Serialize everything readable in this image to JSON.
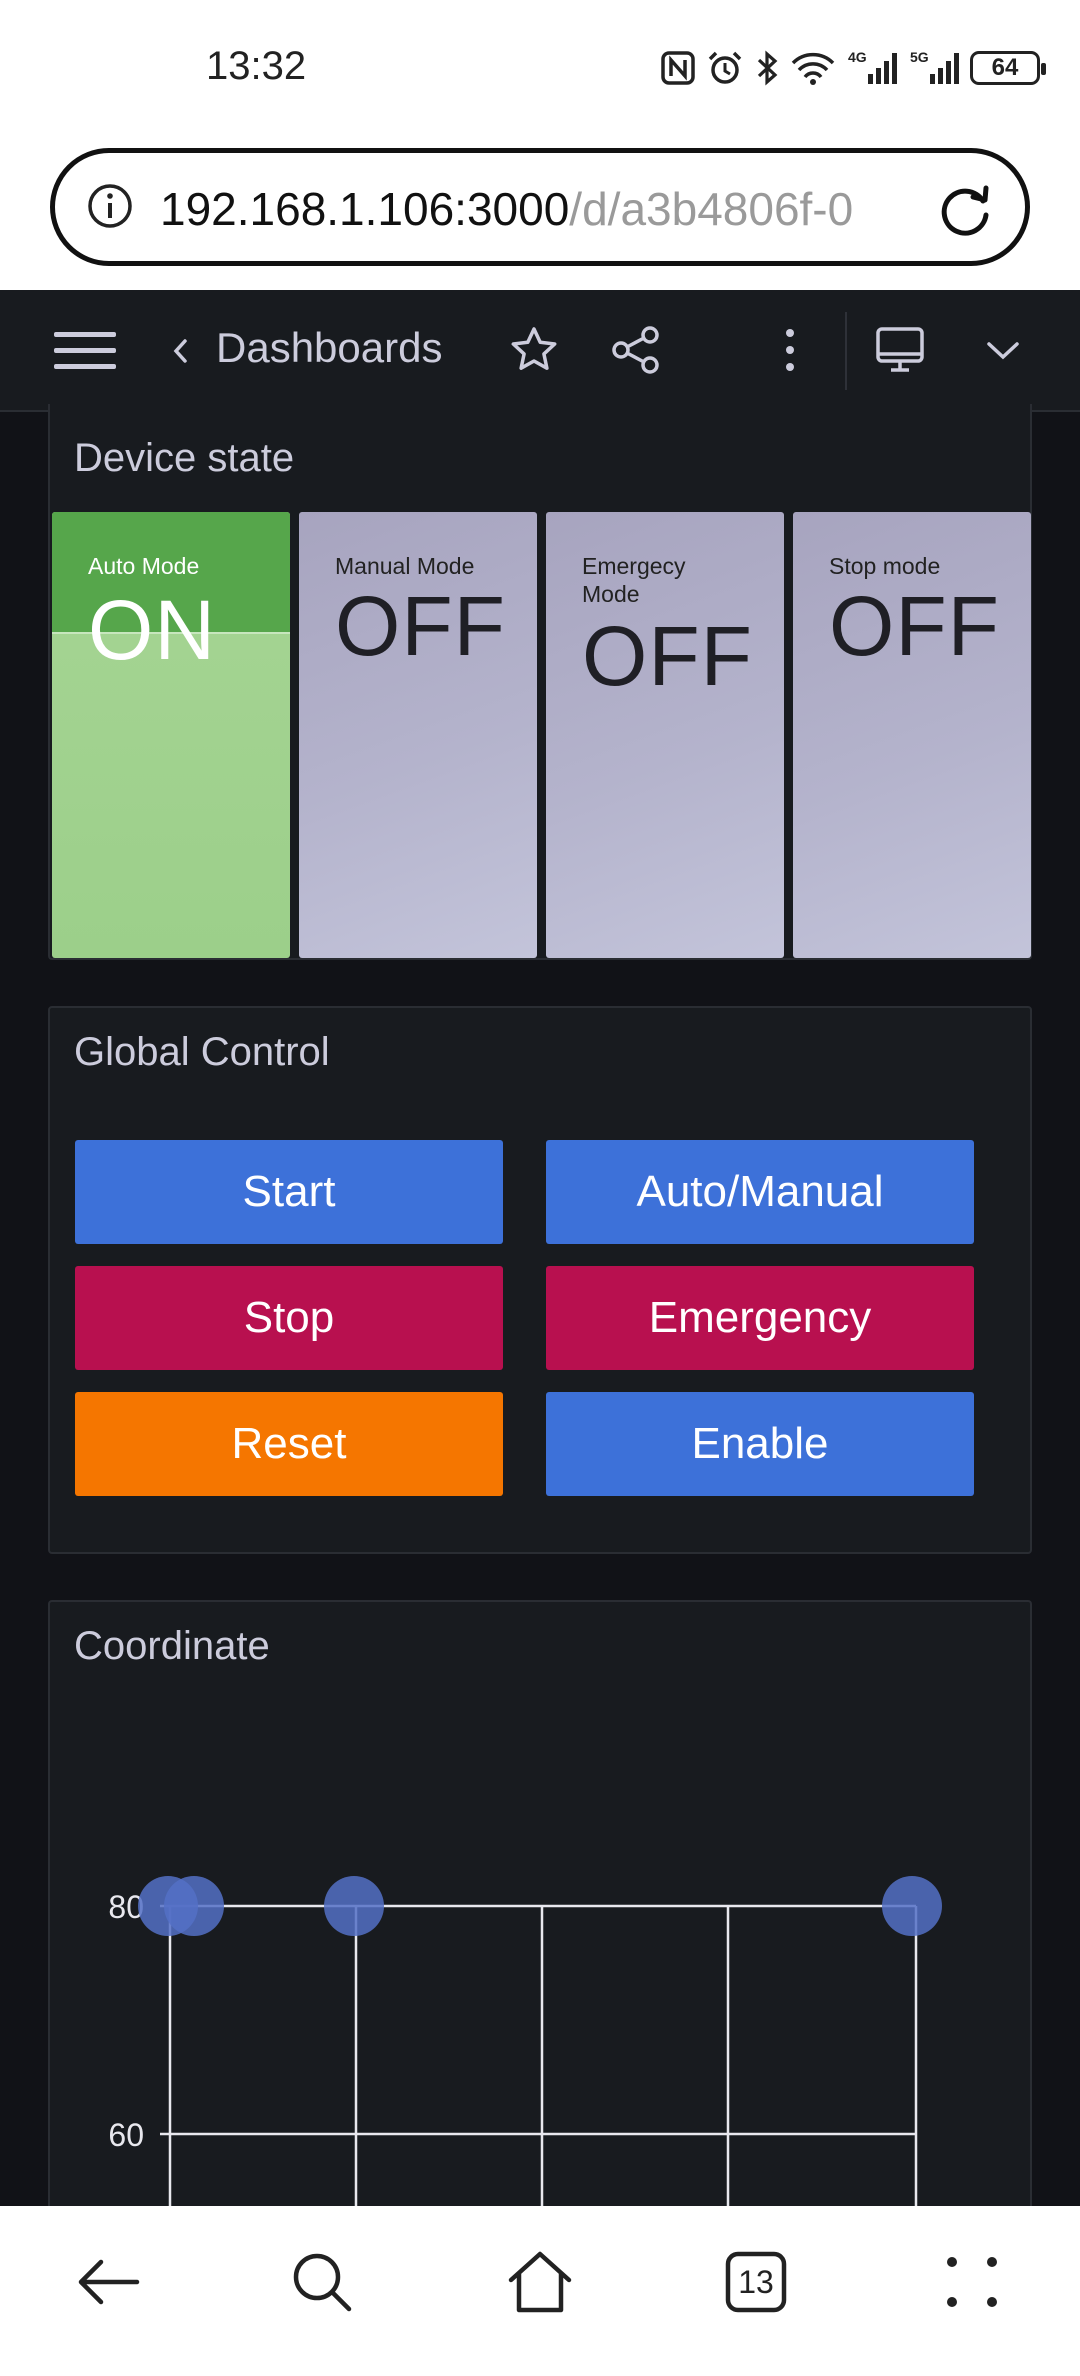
{
  "status_bar": {
    "time": "13:32",
    "network_4g": "4G",
    "network_5g": "5G",
    "battery": "64"
  },
  "browser": {
    "url_host": "192.168.1.106:3000",
    "url_path": "/d/a3b4806f-0",
    "tab_count": "13"
  },
  "toolbar": {
    "title": "Dashboards"
  },
  "device_state": {
    "title": "Device state",
    "tiles": [
      {
        "label": "Auto Mode",
        "value": "ON",
        "color": "#56a64b"
      },
      {
        "label": "Manual Mode",
        "value": "OFF"
      },
      {
        "label": "Emergecy Mode",
        "value": "OFF"
      },
      {
        "label": "Stop mode",
        "value": "OFF"
      }
    ]
  },
  "global_control": {
    "title": "Global Control",
    "buttons": [
      {
        "label": "Start",
        "color": "#3d71d9"
      },
      {
        "label": "Auto/Manual",
        "color": "#3d71d9"
      },
      {
        "label": "Stop",
        "color": "#b8104f"
      },
      {
        "label": "Emergency",
        "color": "#b8104f"
      },
      {
        "label": "Reset",
        "color": "#f57600"
      },
      {
        "label": "Enable",
        "color": "#3d71d9"
      }
    ]
  },
  "coordinate": {
    "title": "Coordinate",
    "chart_data": {
      "type": "scatter",
      "title": "Coordinate",
      "y_ticks": [
        80,
        60
      ],
      "points_y": [
        80,
        80,
        80,
        80
      ],
      "point_color": "#5470c6",
      "grid": true
    }
  },
  "icons": {
    "nfc": "nfc-icon",
    "alarm": "alarm-icon",
    "bluetooth": "bluetooth-icon",
    "wifi": "wifi-icon",
    "info": "info-icon",
    "reload": "reload-icon",
    "menu": "menu-icon",
    "back_chevron": "chevron-left-icon",
    "star": "star-icon",
    "share": "share-icon",
    "more": "more-vertical-icon",
    "tv": "tv-mode-icon",
    "chevron_down": "chevron-down-icon",
    "nav_back": "arrow-left-icon",
    "nav_search": "search-icon",
    "nav_home": "home-icon",
    "nav_tabs": "tabs-icon",
    "nav_menu": "dots-menu-icon"
  }
}
